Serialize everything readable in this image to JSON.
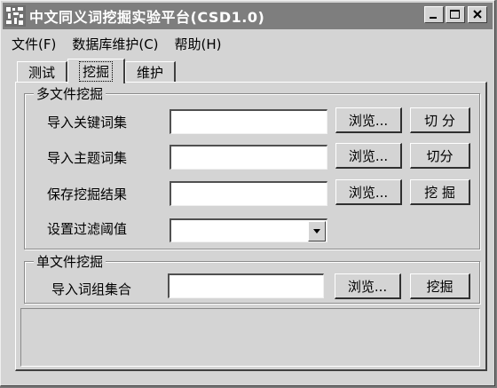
{
  "window": {
    "title": "中文同义词挖掘实验平台(CSD1.0)"
  },
  "titlebar_buttons": {
    "minimize_icon": "minimize-icon",
    "maximize_icon": "maximize-icon",
    "close_icon": "close-icon"
  },
  "menu": {
    "items": [
      {
        "label": "文件(F)"
      },
      {
        "label": "数据库维护(C)"
      },
      {
        "label": "帮助(H)"
      }
    ]
  },
  "tabs": [
    {
      "label": "测试",
      "active": false
    },
    {
      "label": "挖掘",
      "active": true
    },
    {
      "label": "维护",
      "active": false
    }
  ],
  "multi_file": {
    "title": "多文件挖掘",
    "keywords_label": "导入关键词集",
    "keywords_value": "",
    "keywords_browse": "浏览...",
    "keywords_split": "切 分",
    "topics_label": "导入主题词集",
    "topics_value": "",
    "topics_browse": "浏览...",
    "topics_split": "切分",
    "save_label": "保存挖掘结果",
    "save_value": "",
    "save_browse": "浏览...",
    "mine_button": "挖  掘",
    "threshold_label": "设置过滤阈值",
    "threshold_value": ""
  },
  "single_file": {
    "title": "单文件挖掘",
    "phrase_label": "导入词组集合",
    "phrase_value": "",
    "phrase_browse": "浏览...",
    "mine_button": "挖掘"
  },
  "colors": {
    "face": "#d4d4d4",
    "titlebar": "#7e7e7e",
    "title_text": "#ffffff"
  }
}
